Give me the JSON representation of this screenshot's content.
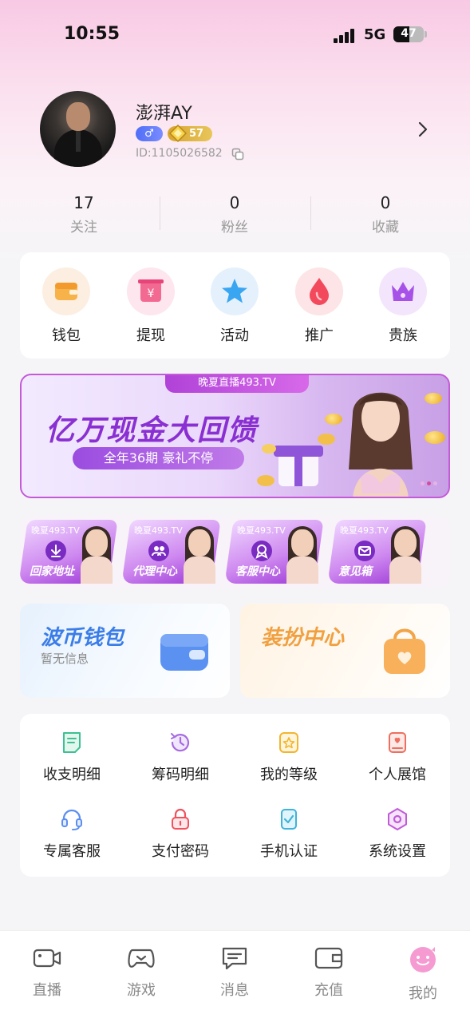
{
  "status_bar": {
    "time": "10:55",
    "network": "5G",
    "battery": "47"
  },
  "profile": {
    "username": "澎湃AY",
    "gender_symbol": "♂",
    "level": "57",
    "user_id": "ID:1105026582"
  },
  "stats": [
    {
      "value": "17",
      "label": "关注"
    },
    {
      "value": "0",
      "label": "粉丝"
    },
    {
      "value": "0",
      "label": "收藏"
    }
  ],
  "quick_actions": [
    {
      "label": "钱包",
      "icon": "wallet-icon",
      "color": "#f3a43a"
    },
    {
      "label": "提现",
      "icon": "withdraw-icon",
      "color": "#f2487a"
    },
    {
      "label": "活动",
      "icon": "star-icon",
      "color": "#3aa0f0"
    },
    {
      "label": "推广",
      "icon": "drop-icon",
      "color": "#f0445a"
    },
    {
      "label": "贵族",
      "icon": "crown-icon",
      "color": "#a452e6"
    }
  ],
  "banner": {
    "tab": "晚夏直播493.TV",
    "title": "亿万现金大回馈",
    "subtitle": "全年36期  豪礼不停"
  },
  "shortcuts": [
    {
      "brand": "晚夏493.TV",
      "label": "回家地址",
      "icon": "download-icon"
    },
    {
      "brand": "晚夏493.TV",
      "label": "代理中心",
      "icon": "people-icon"
    },
    {
      "brand": "晚夏493.TV",
      "label": "客服中心",
      "icon": "service-icon"
    },
    {
      "brand": "晚夏493.TV",
      "label": "意见箱",
      "icon": "mail-icon"
    }
  ],
  "promo_cards": [
    {
      "title": "波币钱包",
      "subtitle": "暂无信息",
      "color": "#3a7de8"
    },
    {
      "title": "装扮中心",
      "subtitle": "",
      "color": "#f0a040"
    }
  ],
  "menu_grid": [
    {
      "label": "收支明细",
      "icon": "receipt-icon"
    },
    {
      "label": "筹码明细",
      "icon": "history-icon"
    },
    {
      "label": "我的等级",
      "icon": "badge-icon"
    },
    {
      "label": "个人展馆",
      "icon": "gallery-icon"
    },
    {
      "label": "专属客服",
      "icon": "headset-icon"
    },
    {
      "label": "支付密码",
      "icon": "lock-icon"
    },
    {
      "label": "手机认证",
      "icon": "phone-check-icon"
    },
    {
      "label": "系统设置",
      "icon": "settings-icon"
    }
  ],
  "bottom_nav": [
    {
      "label": "直播",
      "icon": "camera-icon"
    },
    {
      "label": "游戏",
      "icon": "gamepad-icon"
    },
    {
      "label": "消息",
      "icon": "message-icon"
    },
    {
      "label": "充值",
      "icon": "recharge-icon"
    },
    {
      "label": "我的",
      "icon": "profile-icon",
      "active": true
    }
  ]
}
